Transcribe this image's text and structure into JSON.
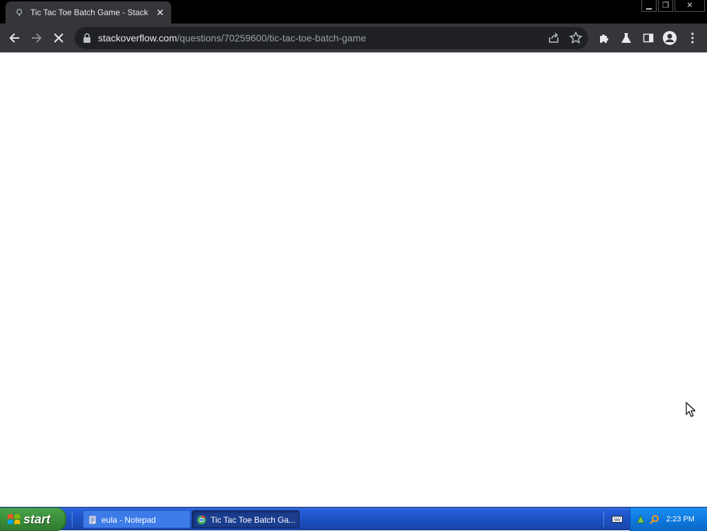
{
  "browser": {
    "tab": {
      "title": "Tic Tac Toe Batch Game - Stack O",
      "close_symbol": "✕"
    },
    "window_controls": {
      "minimize": "▁",
      "restore": "❐",
      "close": "✕"
    },
    "url": {
      "domain": "stackoverflow.com",
      "path": "/questions/70259600/tic-tac-toe-batch-game"
    },
    "icons": [
      "back-arrow-icon",
      "forward-arrow-icon",
      "stop-icon",
      "lock-icon",
      "share-icon",
      "star-icon",
      "extensions-icon",
      "labs-icon",
      "side-panel-icon",
      "profile-icon",
      "menu-icon"
    ]
  },
  "taskbar": {
    "start_label": "start",
    "tasks": [
      {
        "label": "eula - Notepad",
        "icon": "notepad-icon",
        "active": false
      },
      {
        "label": "Tic Tac Toe Batch Ga...",
        "icon": "chrome-icon",
        "active": true
      }
    ],
    "clock": "2:23 PM"
  },
  "colors": {
    "titlebar": "#000000",
    "toolbar": "#35363a",
    "omnibox": "#202124",
    "taskbar_blue": "#245edb",
    "start_green": "#3c8f3c",
    "tray_blue": "#0f7ae0"
  }
}
